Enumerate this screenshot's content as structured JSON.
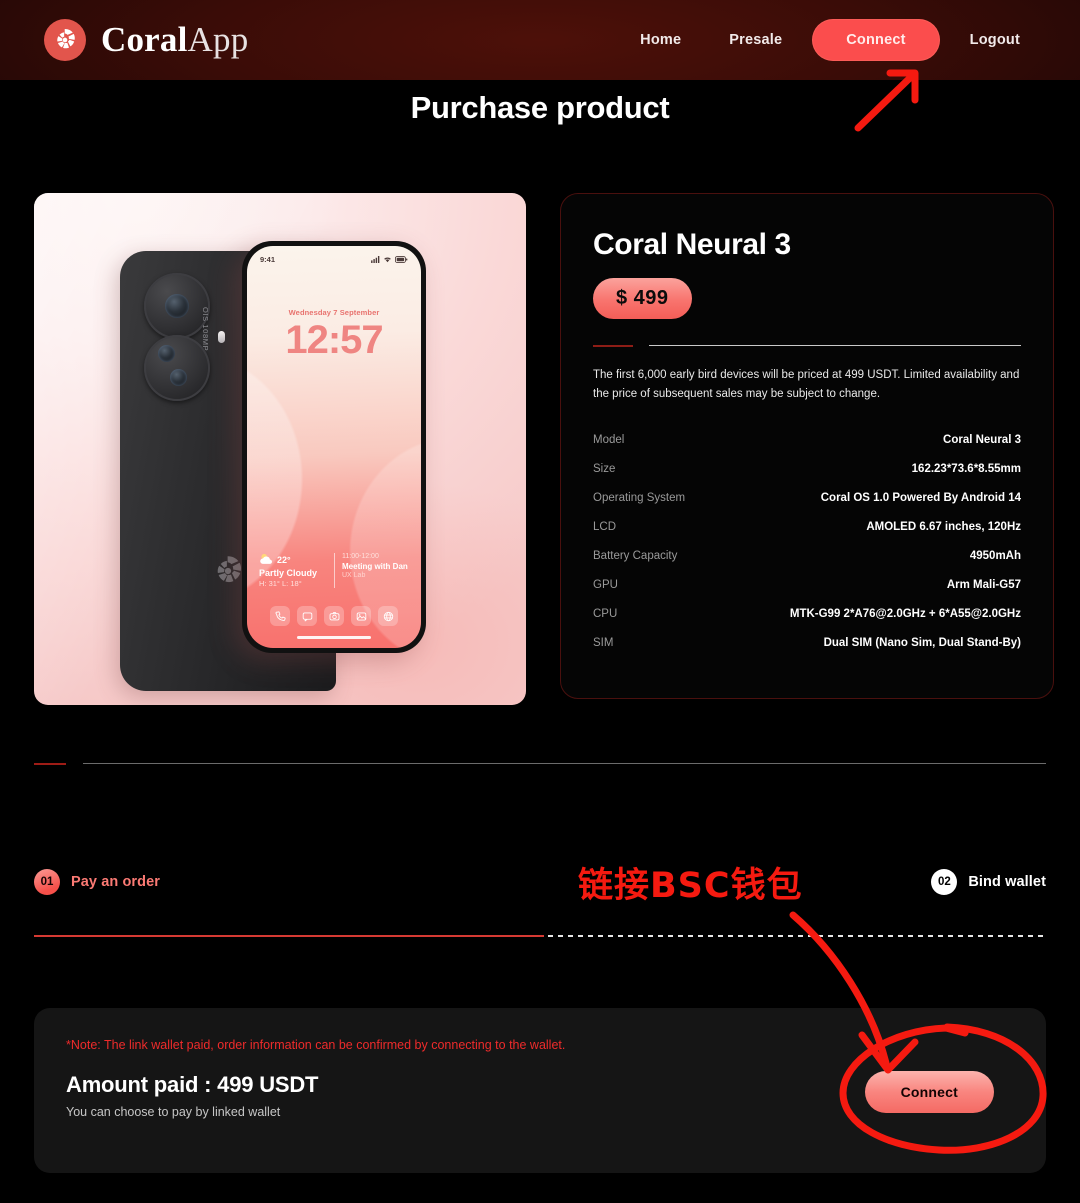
{
  "header": {
    "logo_icon": "coral-shell-icon",
    "brand_bold": "Coral",
    "brand_light": "App",
    "nav": [
      {
        "label": "Home",
        "name": "nav-home"
      },
      {
        "label": "Presale",
        "name": "nav-presale"
      },
      {
        "label": "Connect",
        "name": "nav-connect"
      },
      {
        "label": "Logout",
        "name": "nav-logout"
      }
    ],
    "connect_label": "Connect"
  },
  "page_title": "Purchase product",
  "phone_preview": {
    "camera_text": "OIS 108MP",
    "back_logo_icon": "coral-shell-icon",
    "status_time": "9:41",
    "lock_date": "Wednesday 7 September",
    "lock_time": "12:57",
    "weather": {
      "temp": "22°",
      "condition": "Partly Cloudy",
      "high_low": "H: 31°  L: 18°",
      "icon": "sun-cloud-icon"
    },
    "calendar": {
      "time": "11:00-12:00",
      "title": "Meeting with Dan",
      "location": "UX Lab"
    },
    "dock": [
      "phone-icon",
      "message-icon",
      "camera-icon",
      "photos-icon",
      "browser-icon"
    ]
  },
  "product": {
    "name": "Coral Neural 3",
    "price": "$ 499",
    "description": "The first 6,000 early bird devices will be priced at 499 USDT. Limited availability and the price of subsequent sales may be subject to change.",
    "specs": [
      {
        "key": "Model",
        "value": "Coral Neural 3"
      },
      {
        "key": "Size",
        "value": "162.23*73.6*8.55mm"
      },
      {
        "key": "Operating System",
        "value": "Coral OS 1.0 Powered By Android 14"
      },
      {
        "key": "LCD",
        "value": "AMOLED 6.67 inches, 120Hz"
      },
      {
        "key": "Battery Capacity",
        "value": "4950mAh"
      },
      {
        "key": "GPU",
        "value": "Arm Mali-G57"
      },
      {
        "key": "CPU",
        "value": "MTK-G99 2*A76@2.0GHz + 6*A55@2.0GHz"
      },
      {
        "key": "SIM",
        "value": "Dual SIM (Nano Sim, Dual Stand-By)"
      }
    ]
  },
  "steps": [
    {
      "number": "01",
      "label": "Pay an order",
      "state": "active"
    },
    {
      "number": "02",
      "label": "Bind wallet",
      "state": "inactive"
    }
  ],
  "payment": {
    "note": "*Note: The link wallet paid, order information can be confirmed by connecting to the wallet.",
    "amount": "Amount paid : 499 USDT",
    "subtext": "You can choose to pay by linked wallet",
    "connect_label": "Connect"
  },
  "annotations": {
    "chinese_note": "链接BSC钱包",
    "color": "#f51a10"
  },
  "colors": {
    "accent": "#f6504a",
    "header_bg": "#3a0c07",
    "page_bg": "#000000",
    "card_bg": "#151515",
    "annotation": "#f51a10"
  }
}
